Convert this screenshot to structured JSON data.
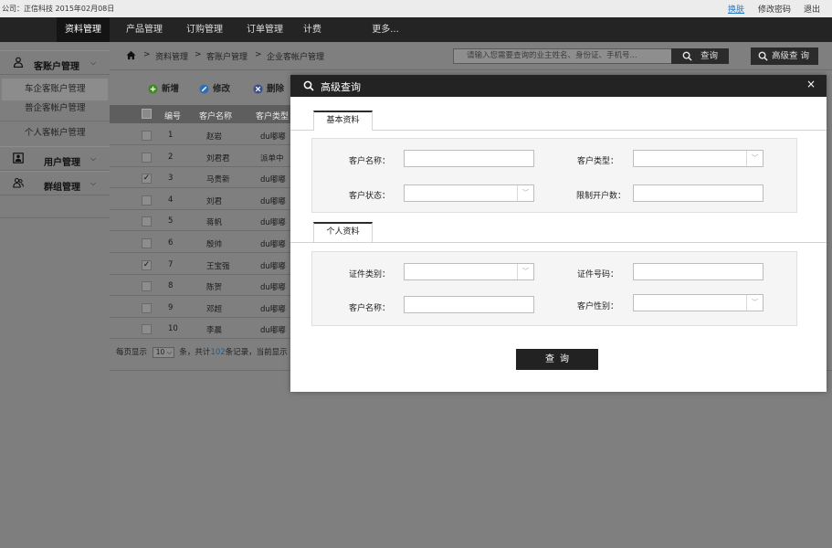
{
  "topbar": {
    "company_label": "公司：正信科技",
    "date": "2015年02月08日",
    "links": [
      "换肤",
      "修改密码",
      "退出"
    ]
  },
  "nav": {
    "items": [
      "资料管理",
      "产品管理",
      "订购管理",
      "订单管理",
      "计费",
      "更多..."
    ],
    "active_index": 0
  },
  "sidebar": {
    "groups": [
      {
        "label": "客账户管理",
        "icon": "user-icon",
        "expanded": true,
        "items": [
          "车企客账户管理",
          "普企客帐户管理",
          "个人客帐户管理"
        ],
        "active_item": 0
      },
      {
        "label": "用户管理",
        "icon": "user-card-icon",
        "expanded": false
      },
      {
        "label": "群组管理",
        "icon": "group-icon",
        "expanded": false
      }
    ]
  },
  "breadcrumb": {
    "items": [
      "资料管理",
      "客账户管理",
      "企业客帐户管理"
    ],
    "separator": ">"
  },
  "search": {
    "placeholder": "请输入您需要查询的业主姓名、身份证、手机号...",
    "button_label": "查询",
    "advanced_label": "高级查 询"
  },
  "toolbar": {
    "add_label": "新增",
    "edit_label": "修改",
    "delete_label": "删除",
    "colors": {
      "add": "#3f8a1f",
      "edit": "#2f6fb6",
      "delete": "#3b4f8a"
    }
  },
  "table": {
    "headers": [
      "编号",
      "客户名称",
      "客户类型"
    ],
    "rows": [
      {
        "no": "1",
        "name": "赵岩",
        "type": "du嘟嘟",
        "checked": false
      },
      {
        "no": "2",
        "name": "刘君君",
        "type": "派单中",
        "checked": false
      },
      {
        "no": "3",
        "name": "马贵新",
        "type": "du嘟嘟",
        "checked": true
      },
      {
        "no": "4",
        "name": "刘君",
        "type": "du嘟嘟",
        "checked": false
      },
      {
        "no": "5",
        "name": "蒋帆",
        "type": "du嘟嘟",
        "checked": false
      },
      {
        "no": "6",
        "name": "殷帅",
        "type": "du嘟嘟",
        "checked": false
      },
      {
        "no": "7",
        "name": "王宝强",
        "type": "du嘟嘟",
        "checked": true
      },
      {
        "no": "8",
        "name": "陈贺",
        "type": "du嘟嘟",
        "checked": false
      },
      {
        "no": "9",
        "name": "邓超",
        "type": "du嘟嘟",
        "checked": false
      },
      {
        "no": "10",
        "name": "李晨",
        "type": "du嘟嘟",
        "checked": false
      }
    ]
  },
  "pager": {
    "prefix": "每页显示",
    "page_size": "10",
    "middle": "条，共计",
    "total": "102",
    "suffix": "条记录，当前显示"
  },
  "modal": {
    "title": "高级查询",
    "close": "×",
    "basic_tab": "基本资料",
    "personal_tab": "个人资料",
    "basic_fields": {
      "customer_name": "客户名称：",
      "customer_type": "客户类型：",
      "customer_status": "客户状态：",
      "account_limit": "限制开户数："
    },
    "personal_fields": {
      "id_type": "证件类别：",
      "id_number": "证件号码：",
      "customer_name": "客户名称：",
      "gender": "客户性别："
    },
    "query_button": "查询"
  }
}
